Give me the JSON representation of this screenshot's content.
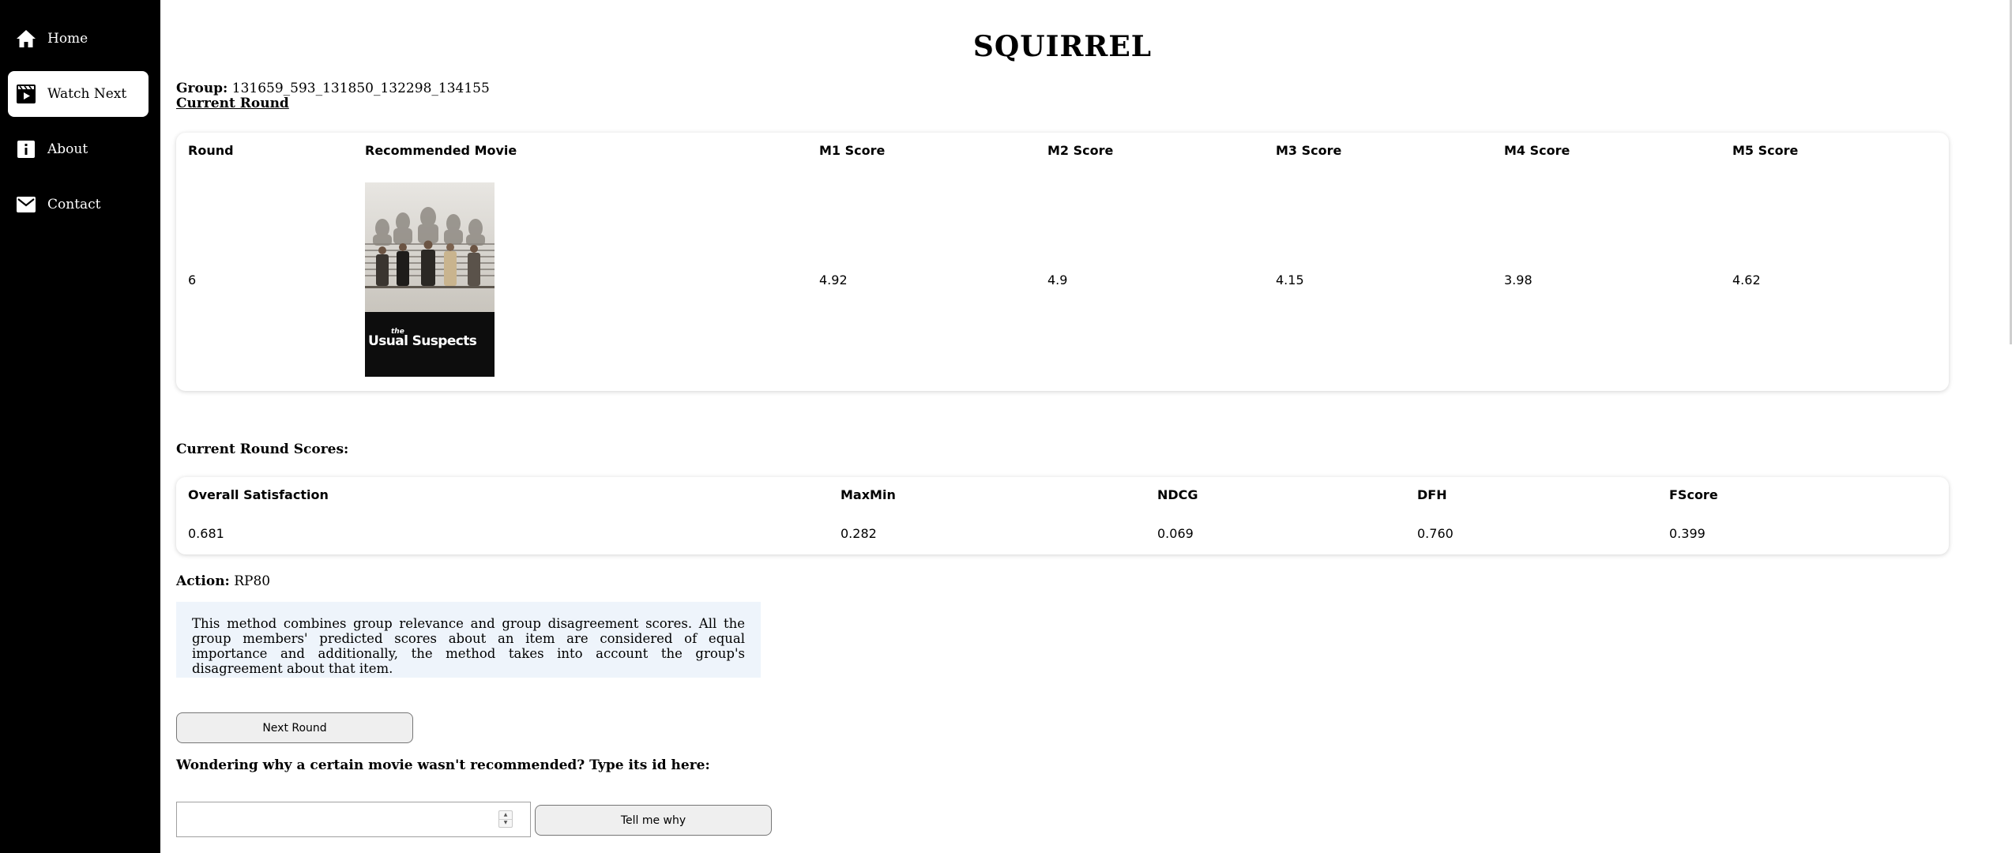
{
  "sidebar": {
    "items": [
      {
        "label": "Home",
        "icon": "home-icon",
        "active": false
      },
      {
        "label": "Watch Next",
        "icon": "clapperboard-icon",
        "active": true
      },
      {
        "label": "About",
        "icon": "info-icon",
        "active": false
      },
      {
        "label": "Contact",
        "icon": "mail-icon",
        "active": false
      }
    ]
  },
  "header": {
    "title": "SQUIRREL"
  },
  "group": {
    "label": "Group:",
    "value": "131659_593_131850_132298_134155"
  },
  "current_round_link": "Current Round",
  "round_table": {
    "headers": [
      "Round",
      "Recommended Movie",
      "M1 Score",
      "M2 Score",
      "M3 Score",
      "M4 Score",
      "M5 Score"
    ],
    "row": {
      "round": "6",
      "movie_poster_caption": "the Usual Suspects",
      "m1": "4.92",
      "m2": "4.9",
      "m3": "4.15",
      "m4": "3.98",
      "m5": "4.62"
    }
  },
  "scores_section": {
    "label": "Current Round Scores:",
    "headers": [
      "Overall Satisfaction",
      "MaxMin",
      "NDCG",
      "DFH",
      "FScore"
    ],
    "values": [
      "0.681",
      "0.282",
      "0.069",
      "0.760",
      "0.399"
    ]
  },
  "action": {
    "label": "Action:",
    "value": "RP80",
    "description": "This method combines group relevance and group disagreement scores. All the group members' predicted scores about an item are considered of equal importance and additionally, the method takes into account the group's disagreement about that item."
  },
  "buttons": {
    "next_round": "Next Round",
    "tell_me_why": "Tell me why"
  },
  "question": "Wondering why a certain movie wasn't recommended? Type its id here:",
  "id_input": {
    "value": "",
    "placeholder": ""
  },
  "colors": {
    "sidebar_bg": "#000000",
    "desc_bg": "#eef4fb",
    "button_bg": "#efefef"
  }
}
